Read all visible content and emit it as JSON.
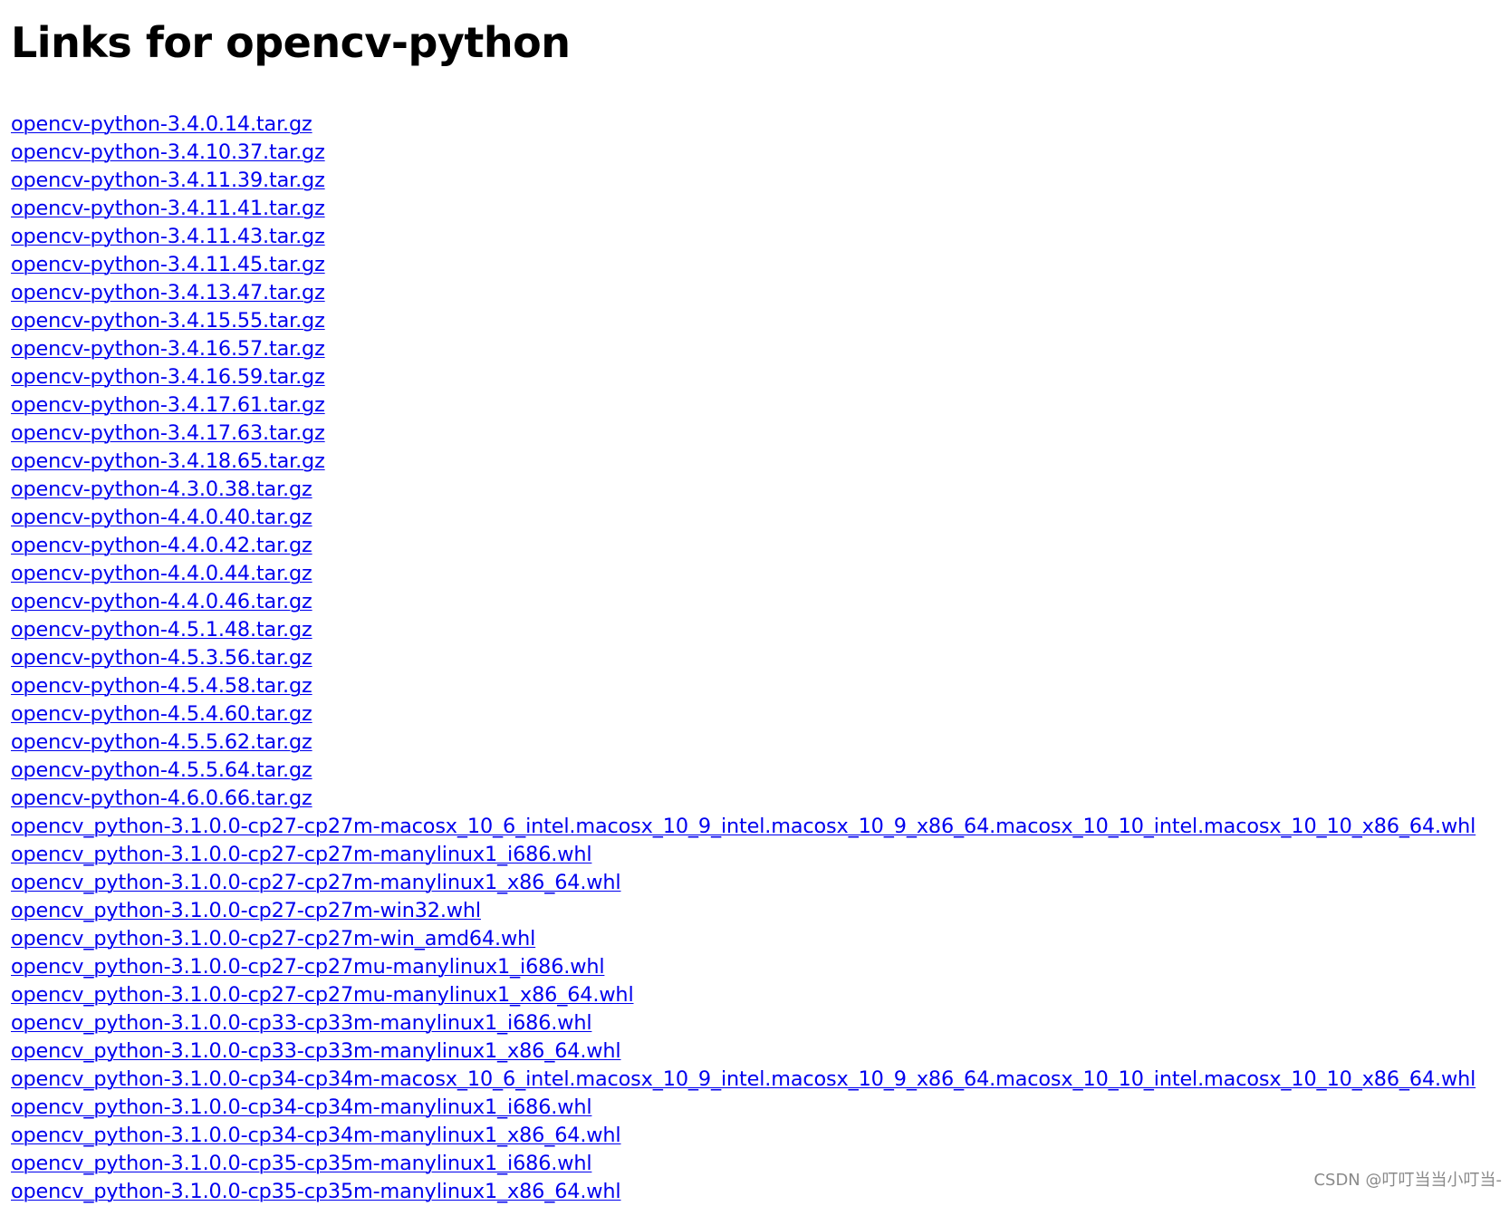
{
  "page": {
    "title": "Links for opencv-python"
  },
  "links": [
    {
      "text": "opencv-python-3.4.0.14.tar.gz"
    },
    {
      "text": "opencv-python-3.4.10.37.tar.gz"
    },
    {
      "text": "opencv-python-3.4.11.39.tar.gz"
    },
    {
      "text": "opencv-python-3.4.11.41.tar.gz"
    },
    {
      "text": "opencv-python-3.4.11.43.tar.gz"
    },
    {
      "text": "opencv-python-3.4.11.45.tar.gz"
    },
    {
      "text": "opencv-python-3.4.13.47.tar.gz"
    },
    {
      "text": "opencv-python-3.4.15.55.tar.gz"
    },
    {
      "text": "opencv-python-3.4.16.57.tar.gz"
    },
    {
      "text": "opencv-python-3.4.16.59.tar.gz"
    },
    {
      "text": "opencv-python-3.4.17.61.tar.gz"
    },
    {
      "text": "opencv-python-3.4.17.63.tar.gz"
    },
    {
      "text": "opencv-python-3.4.18.65.tar.gz"
    },
    {
      "text": "opencv-python-4.3.0.38.tar.gz"
    },
    {
      "text": "opencv-python-4.4.0.40.tar.gz"
    },
    {
      "text": "opencv-python-4.4.0.42.tar.gz"
    },
    {
      "text": "opencv-python-4.4.0.44.tar.gz"
    },
    {
      "text": "opencv-python-4.4.0.46.tar.gz"
    },
    {
      "text": "opencv-python-4.5.1.48.tar.gz"
    },
    {
      "text": "opencv-python-4.5.3.56.tar.gz"
    },
    {
      "text": "opencv-python-4.5.4.58.tar.gz"
    },
    {
      "text": "opencv-python-4.5.4.60.tar.gz"
    },
    {
      "text": "opencv-python-4.5.5.62.tar.gz"
    },
    {
      "text": "opencv-python-4.5.5.64.tar.gz"
    },
    {
      "text": "opencv-python-4.6.0.66.tar.gz"
    },
    {
      "text": "opencv_python-3.1.0.0-cp27-cp27m-macosx_10_6_intel.macosx_10_9_intel.macosx_10_9_x86_64.macosx_10_10_intel.macosx_10_10_x86_64.whl"
    },
    {
      "text": "opencv_python-3.1.0.0-cp27-cp27m-manylinux1_i686.whl"
    },
    {
      "text": "opencv_python-3.1.0.0-cp27-cp27m-manylinux1_x86_64.whl"
    },
    {
      "text": "opencv_python-3.1.0.0-cp27-cp27m-win32.whl"
    },
    {
      "text": "opencv_python-3.1.0.0-cp27-cp27m-win_amd64.whl"
    },
    {
      "text": "opencv_python-3.1.0.0-cp27-cp27mu-manylinux1_i686.whl"
    },
    {
      "text": "opencv_python-3.1.0.0-cp27-cp27mu-manylinux1_x86_64.whl"
    },
    {
      "text": "opencv_python-3.1.0.0-cp33-cp33m-manylinux1_i686.whl"
    },
    {
      "text": "opencv_python-3.1.0.0-cp33-cp33m-manylinux1_x86_64.whl"
    },
    {
      "text": "opencv_python-3.1.0.0-cp34-cp34m-macosx_10_6_intel.macosx_10_9_intel.macosx_10_9_x86_64.macosx_10_10_intel.macosx_10_10_x86_64.whl"
    },
    {
      "text": "opencv_python-3.1.0.0-cp34-cp34m-manylinux1_i686.whl"
    },
    {
      "text": "opencv_python-3.1.0.0-cp34-cp34m-manylinux1_x86_64.whl"
    },
    {
      "text": "opencv_python-3.1.0.0-cp35-cp35m-manylinux1_i686.whl"
    },
    {
      "text": "opencv_python-3.1.0.0-cp35-cp35m-manylinux1_x86_64.whl"
    }
  ],
  "watermark": {
    "text": "CSDN @叮叮当当小叮当-"
  },
  "colors": {
    "link": "#0000ee",
    "title": "#000000",
    "background": "#ffffff",
    "watermark": "#8a8a8a"
  }
}
